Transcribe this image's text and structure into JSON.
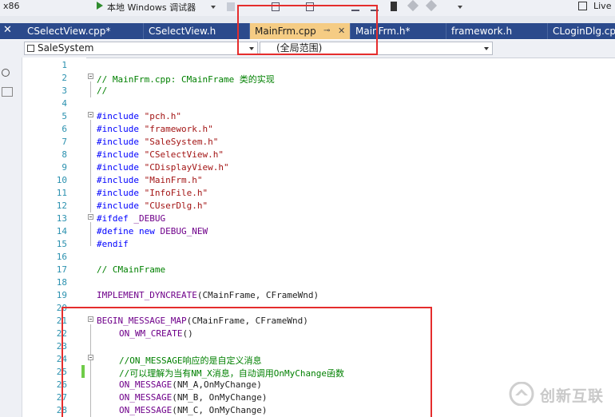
{
  "toolbar": {
    "platform": "x86",
    "run_label": "本地 Windows 调试器",
    "live_label": "Live"
  },
  "tabs": [
    {
      "label": "CSelectView.cpp*",
      "active": false
    },
    {
      "label": "CSelectView.h",
      "active": false
    },
    {
      "label": "MainFrm.cpp",
      "active": true
    },
    {
      "label": "MainFrm.h*",
      "active": false
    },
    {
      "label": "framework.h",
      "active": false
    },
    {
      "label": "CLoginDlg.cp",
      "active": false
    }
  ],
  "tab_pin_glyph": "⊸",
  "tab_close_glyph": "✕",
  "navbar": {
    "project": "SaleSystem",
    "scope": "(全局范围)"
  },
  "line_numbers": [
    "1",
    "2",
    "3",
    "4",
    "5",
    "6",
    "7",
    "8",
    "9",
    "10",
    "11",
    "12",
    "13",
    "14",
    "15",
    "16",
    "17",
    "18",
    "19",
    "20",
    "21",
    "22",
    "23",
    "24",
    "25",
    "26",
    "27",
    "28"
  ],
  "code": {
    "l2": "// MainFrm.cpp: CMainFrame 类的实现",
    "l3": "//",
    "l5_kw": "#include",
    "l5_str": "\"pch.h\"",
    "l6_kw": "#include",
    "l6_str": "\"framework.h\"",
    "l7_kw": "#include",
    "l7_str": "\"SaleSystem.h\"",
    "l8_kw": "#include",
    "l8_str": "\"CSelectView.h\"",
    "l9_kw": "#include",
    "l9_str": "\"CDisplayView.h\"",
    "l10_kw": "#include",
    "l10_str": "\"MainFrm.h\"",
    "l11_kw": "#include",
    "l11_str": "\"InfoFile.h\"",
    "l12_kw": "#include",
    "l12_str": "\"CUserDlg.h\"",
    "l13_kw": "#ifdef",
    "l13_mac": "_DEBUG",
    "l14_kw": "#define",
    "l14_kw2": "new",
    "l14_mac": "DEBUG_NEW",
    "l15_kw": "#endif",
    "l17": "// CMainFrame",
    "l19_mac": "IMPLEMENT_DYNCREATE",
    "l19_rest": "(CMainFrame, CFrameWnd)",
    "l21_mac": "BEGIN_MESSAGE_MAP",
    "l21_rest": "(CMainFrame, CFrameWnd)",
    "l22_mac": "ON_WM_CREATE",
    "l22_rest": "()",
    "l24": "//ON_MESSAGE响应的是自定义消息",
    "l25": "//可以理解为当有NM_X消息，自动调用OnMyChange函数",
    "l26_mac": "ON_MESSAGE",
    "l26_rest": "(NM_A,OnMyChange)",
    "l27_mac": "ON_MESSAGE",
    "l27_rest": "(NM_B, OnMyChange)",
    "l28_mac": "ON_MESSAGE",
    "l28_rest": "(NM_C, OnMyChange)"
  },
  "watermark": {
    "text": "创新互联"
  }
}
